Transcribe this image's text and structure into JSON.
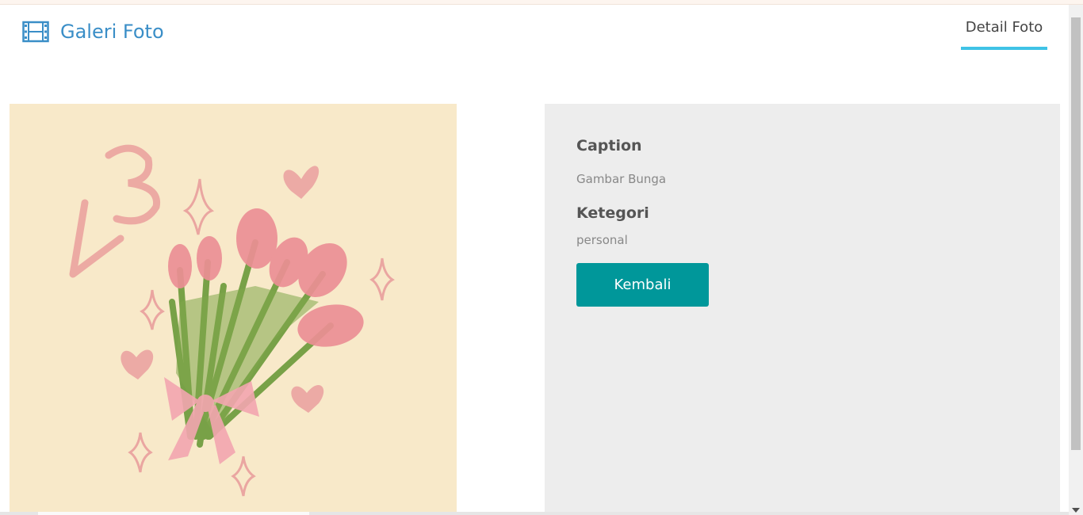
{
  "header": {
    "brand_title": "Galeri Foto",
    "brand_icon": "film-icon",
    "nav_tab_label": "Detail Foto"
  },
  "photo": {
    "icon": "photo-flower-bouquet",
    "accent_color": "#f8e9c9"
  },
  "detail": {
    "caption_label": "Caption",
    "caption_value": "Gambar Bunga",
    "category_label": "Ketegori",
    "category_value": "personal",
    "back_button_label": "Kembali"
  },
  "colors": {
    "brand": "#3a8ec7",
    "tab_underline": "#3fc3e6",
    "button": "#00979a",
    "panel": "#ededed"
  }
}
